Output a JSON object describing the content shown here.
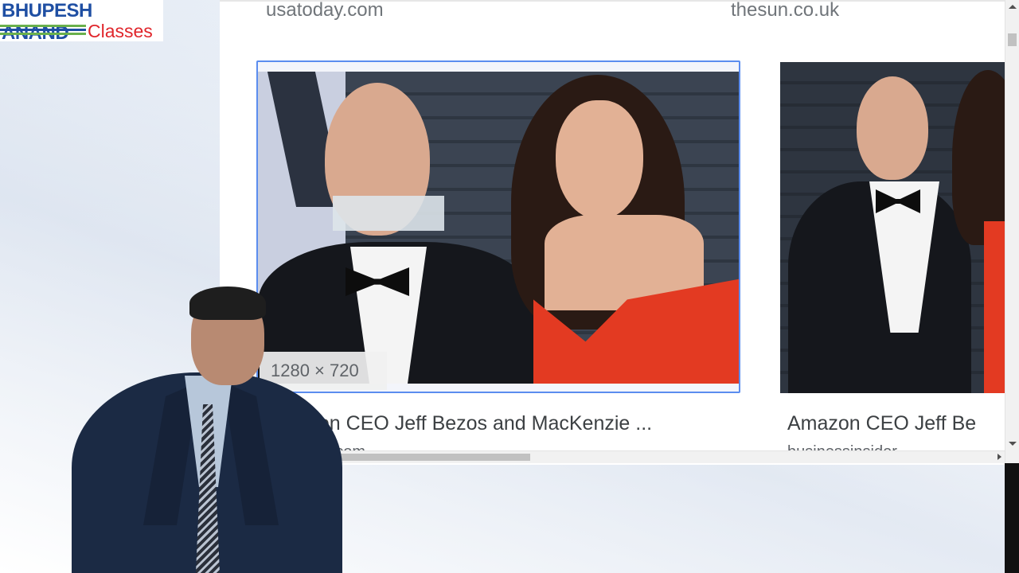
{
  "logo": {
    "line1": "BHUPESH ANAND",
    "line2": "Classes",
    "colors": {
      "blue": "#1f4fa3",
      "red": "#e0252b",
      "green": "#6ab04c"
    }
  },
  "results": [
    {
      "source": "usatoday.com",
      "dimensions": "1280 × 720",
      "title": "Amazon CEO Jeff Bezos and MacKenzie ...",
      "subtitle": "usatoday.com",
      "selected": true
    },
    {
      "source": "thesun.co.uk",
      "title": "Amazon CEO Jeff Be",
      "subtitle": "businessinsider",
      "selected": false
    }
  ],
  "colors": {
    "selection_border": "#5b8def",
    "text_secondary": "#70757a",
    "text_primary": "#3c4043"
  }
}
